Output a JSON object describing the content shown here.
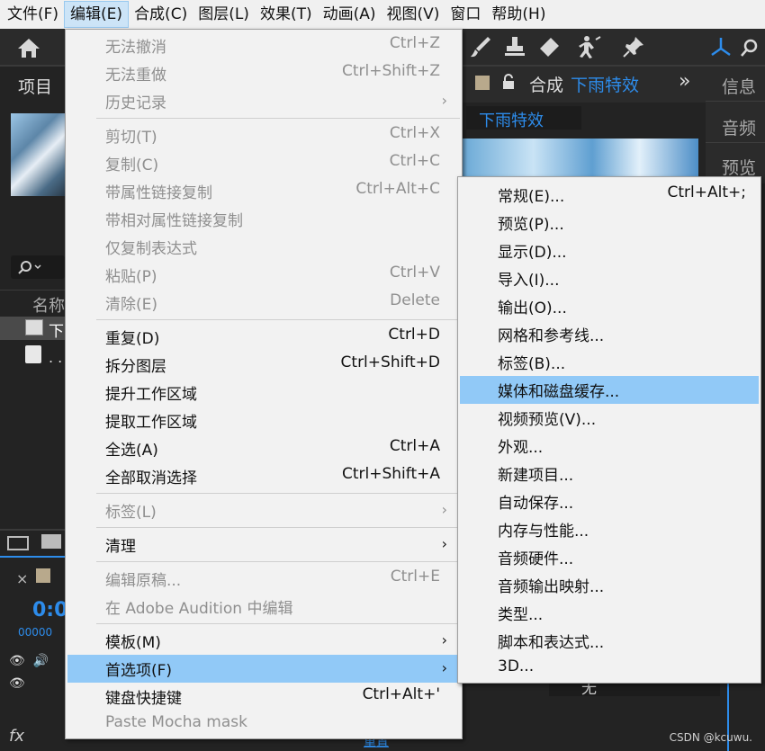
{
  "menubar": {
    "items": [
      {
        "label": "文件(F)",
        "name": "menu-file"
      },
      {
        "label": "编辑(E)",
        "name": "menu-edit",
        "active": true
      },
      {
        "label": "合成(C)",
        "name": "menu-composition"
      },
      {
        "label": "图层(L)",
        "name": "menu-layer"
      },
      {
        "label": "效果(T)",
        "name": "menu-effect"
      },
      {
        "label": "动画(A)",
        "name": "menu-animation"
      },
      {
        "label": "视图(V)",
        "name": "menu-view"
      },
      {
        "label": "窗口",
        "name": "menu-window"
      },
      {
        "label": "帮助(H)",
        "name": "menu-help"
      }
    ]
  },
  "background": {
    "project_tab": "项目",
    "comp_tab_prefix": "合成",
    "comp_name": "下雨特效",
    "comp_view_label": "下雨特效",
    "right_panels": [
      "信息",
      "音频",
      "预览"
    ],
    "name_column": "名称",
    "timecode": "0:0",
    "timecode_frames": "00000",
    "layer_name": "下",
    "bottom_value": "无",
    "fx_label": "fx",
    "bottom_link": "重置",
    "double_chevron": "»"
  },
  "edit_menu": {
    "items": [
      {
        "label": "无法撤消",
        "shortcut": "Ctrl+Z",
        "enabled": false
      },
      {
        "label": "无法重做",
        "shortcut": "Ctrl+Shift+Z",
        "enabled": false
      },
      {
        "label": "历史记录",
        "shortcut": "",
        "enabled": false,
        "submenu": true
      },
      {
        "sep": true
      },
      {
        "label": "剪切(T)",
        "shortcut": "Ctrl+X",
        "enabled": false
      },
      {
        "label": "复制(C)",
        "shortcut": "Ctrl+C",
        "enabled": false
      },
      {
        "label": "带属性链接复制",
        "shortcut": "Ctrl+Alt+C",
        "enabled": false
      },
      {
        "label": "带相对属性链接复制",
        "shortcut": "",
        "enabled": false
      },
      {
        "label": "仅复制表达式",
        "shortcut": "",
        "enabled": false
      },
      {
        "label": "粘贴(P)",
        "shortcut": "Ctrl+V",
        "enabled": false
      },
      {
        "label": "清除(E)",
        "shortcut": "Delete",
        "enabled": false
      },
      {
        "sep": true
      },
      {
        "label": "重复(D)",
        "shortcut": "Ctrl+D",
        "enabled": true
      },
      {
        "label": "拆分图层",
        "shortcut": "Ctrl+Shift+D",
        "enabled": true
      },
      {
        "label": "提升工作区域",
        "shortcut": "",
        "enabled": true
      },
      {
        "label": "提取工作区域",
        "shortcut": "",
        "enabled": true
      },
      {
        "label": "全选(A)",
        "shortcut": "Ctrl+A",
        "enabled": true
      },
      {
        "label": "全部取消选择",
        "shortcut": "Ctrl+Shift+A",
        "enabled": true
      },
      {
        "sep": true
      },
      {
        "label": "标签(L)",
        "shortcut": "",
        "enabled": false,
        "submenu": true
      },
      {
        "sep": true
      },
      {
        "label": "清理",
        "shortcut": "",
        "enabled": true,
        "submenu": true
      },
      {
        "sep": true
      },
      {
        "label": "编辑原稿...",
        "shortcut": "Ctrl+E",
        "enabled": false
      },
      {
        "label": "在 Adobe Audition 中编辑",
        "shortcut": "",
        "enabled": false
      },
      {
        "sep": true
      },
      {
        "label": "模板(M)",
        "shortcut": "",
        "enabled": true,
        "submenu": true
      },
      {
        "label": "首选项(F)",
        "shortcut": "",
        "enabled": true,
        "submenu": true,
        "highlighted": true
      },
      {
        "label": "键盘快捷键",
        "shortcut": "Ctrl+Alt+'",
        "enabled": true
      },
      {
        "label": "Paste Mocha mask",
        "shortcut": "",
        "enabled": false
      }
    ]
  },
  "preferences_submenu": {
    "items": [
      {
        "label": "常规(E)...",
        "shortcut": "Ctrl+Alt+;"
      },
      {
        "label": "预览(P)...",
        "shortcut": ""
      },
      {
        "label": "显示(D)...",
        "shortcut": ""
      },
      {
        "label": "导入(I)...",
        "shortcut": ""
      },
      {
        "label": "输出(O)...",
        "shortcut": ""
      },
      {
        "label": "网格和参考线...",
        "shortcut": ""
      },
      {
        "label": "标签(B)...",
        "shortcut": ""
      },
      {
        "label": "媒体和磁盘缓存...",
        "shortcut": "",
        "highlighted": true
      },
      {
        "label": "视频预览(V)...",
        "shortcut": ""
      },
      {
        "label": "外观...",
        "shortcut": ""
      },
      {
        "label": "新建项目...",
        "shortcut": ""
      },
      {
        "label": "自动保存...",
        "shortcut": ""
      },
      {
        "label": "内存与性能...",
        "shortcut": ""
      },
      {
        "label": "音频硬件...",
        "shortcut": ""
      },
      {
        "label": "音频输出映射...",
        "shortcut": ""
      },
      {
        "label": "类型...",
        "shortcut": ""
      },
      {
        "label": "脚本和表达式...",
        "shortcut": ""
      },
      {
        "label": "3D...",
        "shortcut": ""
      }
    ]
  },
  "watermark": "CSDN @kcuwu.",
  "colors": {
    "menu_bg": "#f2f2f2",
    "highlight": "#91c9f7",
    "app_bg": "#232323",
    "accent_blue": "#2d8ceb"
  }
}
